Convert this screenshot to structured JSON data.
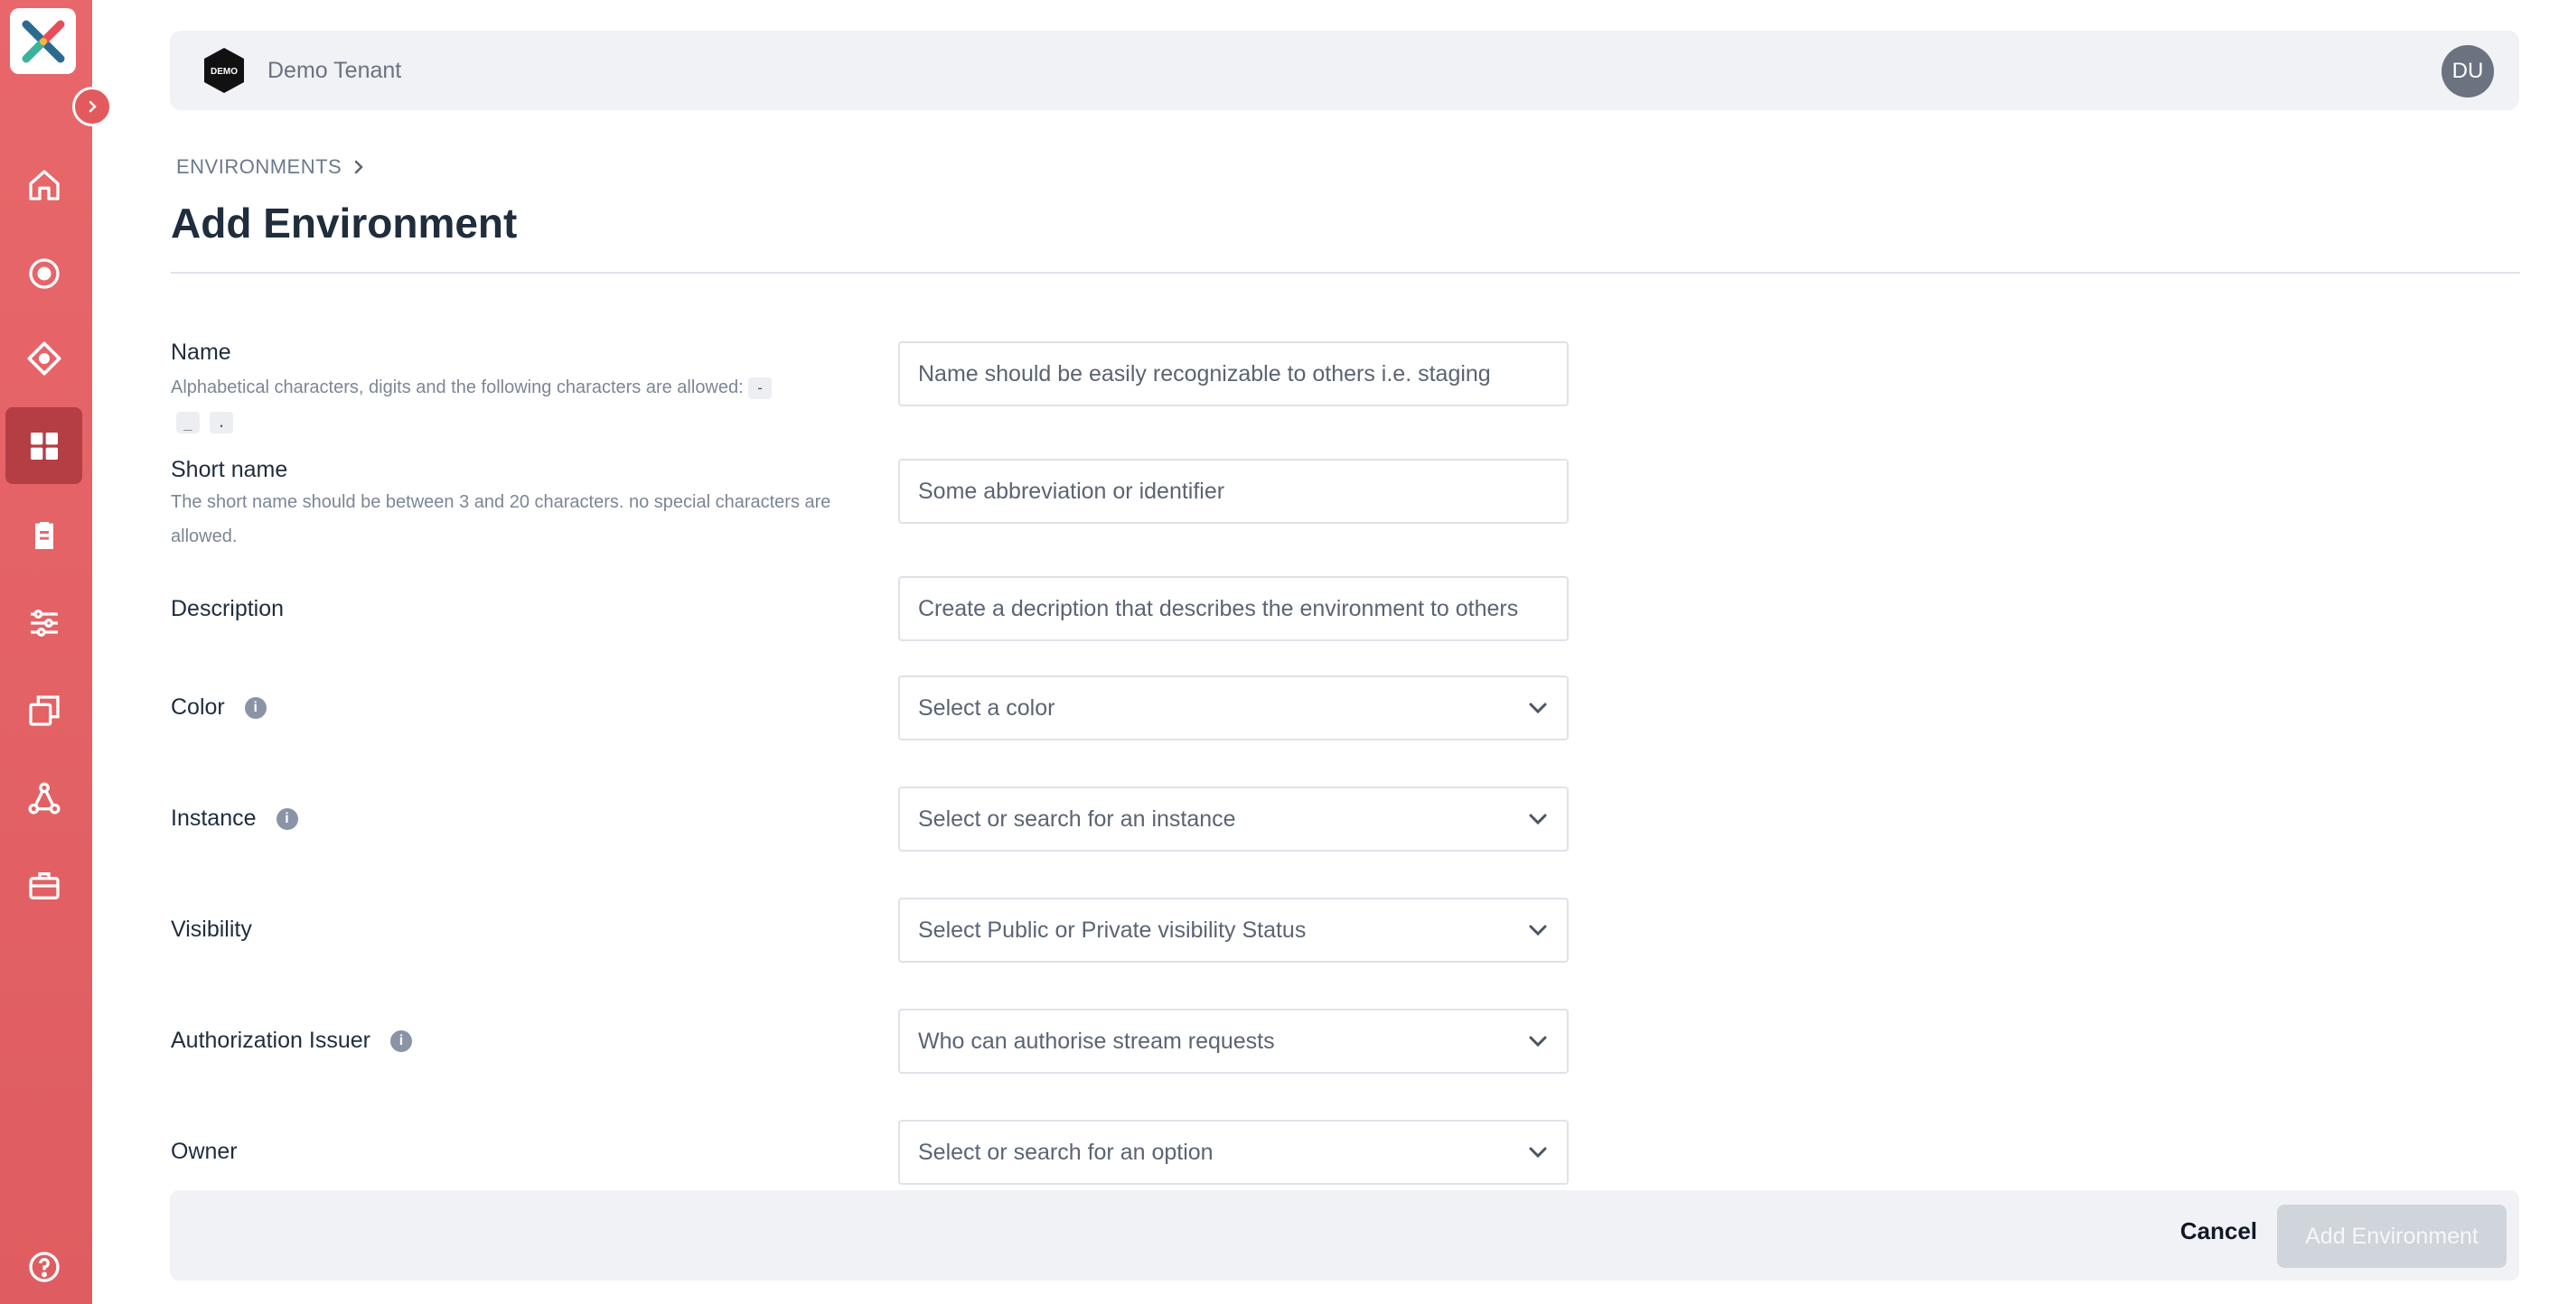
{
  "tenant": {
    "name": "Demo Tenant",
    "logo_text": "DEMO"
  },
  "user": {
    "initials": "DU"
  },
  "breadcrumb": {
    "root": "ENVIRONMENTS"
  },
  "page": {
    "title": "Add Environment"
  },
  "form": {
    "name": {
      "label": "Name",
      "help": "Alphabetical characters, digits and the following characters are allowed:",
      "allowed_chars": [
        "-",
        "_",
        "."
      ],
      "placeholder": "Name should be easily recognizable to others i.e. staging"
    },
    "short_name": {
      "label": "Short name",
      "help": "The short name should be between 3 and 20 characters. no special characters are allowed.",
      "placeholder": "Some abbreviation or identifier"
    },
    "description": {
      "label": "Description",
      "placeholder": "Create a decription that describes the environment to others"
    },
    "color": {
      "label": "Color",
      "placeholder": "Select a color"
    },
    "instance": {
      "label": "Instance",
      "placeholder": "Select or search for an instance"
    },
    "visibility": {
      "label": "Visibility",
      "placeholder": "Select Public or Private visibility Status"
    },
    "authorization_issuer": {
      "label": "Authorization Issuer",
      "placeholder": "Who can authorise stream requests"
    },
    "owner": {
      "label": "Owner",
      "placeholder": "Select or search for an option"
    }
  },
  "footer": {
    "cancel_label": "Cancel",
    "submit_label": "Add Environment"
  },
  "colors": {
    "sidebar": "#e8676a",
    "sidebar_active": "#b53e45",
    "title": "#1f2d3d",
    "disabled_button": "#d0d5dc"
  },
  "icons": [
    "home-icon",
    "target-icon",
    "diamond-icon",
    "dashboard-icon",
    "clipboard-icon",
    "sliders-icon",
    "copy-icon",
    "network-icon",
    "toolbox-icon",
    "help-icon"
  ]
}
